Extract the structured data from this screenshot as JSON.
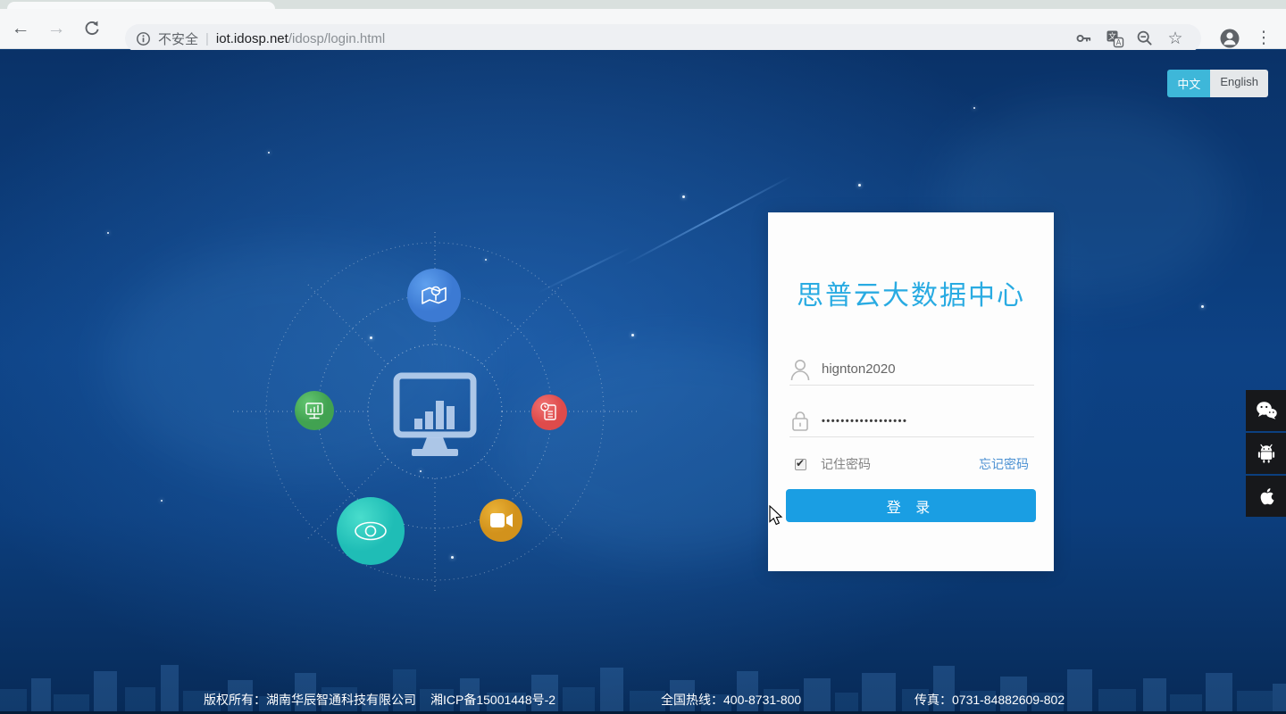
{
  "browser": {
    "security_label": "不安全",
    "url_separator": "|",
    "url_host": "iot.idosp.net",
    "url_path": "/idosp/login.html"
  },
  "language": {
    "chinese_label": "中文",
    "english_label": "English",
    "active": "中文"
  },
  "login": {
    "title": "思普云大数据中心",
    "username": {
      "value": "hignton2020"
    },
    "password": {
      "masked_value": "••••••••••••••••••"
    },
    "remember_label": "记住密码",
    "remember_checked": true,
    "forgot_password_label": "忘记密码",
    "login_button_label": "登 录"
  },
  "footer": {
    "copyright": "版权所有：湖南华辰智通科技有限公司",
    "icp_number": "湘ICP备15001448号-2",
    "hotline": "全国热线：400-8731-800",
    "fax": "传真：0731-84882609-802"
  },
  "colors": {
    "accent_button_blue": "#1a9ee3",
    "title_cyan": "#29abe2",
    "link_blue": "#4a90d2",
    "lang_active_bg": "#3eb7d9",
    "page_bg_top": "#0a3268",
    "page_bg_mid": "#0d4285",
    "hub_blue": "#4a8fe0",
    "hub_green": "#55b761",
    "hub_red": "#e85d5d",
    "hub_teal": "#2fd0c4",
    "hub_orange": "#df9f27",
    "social_bg": "#17181b"
  },
  "icons": {
    "back": "←",
    "forward": "→",
    "reload": "circular-arrow",
    "info": "circle-i",
    "key": "key-shape",
    "translate": "translate-squares",
    "zoom_out": "magnifier-minus",
    "bookmark": "☆",
    "profile": "avatar-circle",
    "menu": "⋮",
    "user_field": "person-outline",
    "password_field": "lock-outline",
    "social": [
      "wechat",
      "android",
      "apple"
    ],
    "hub": [
      "map-pin",
      "dashboard-monitor",
      "device-monitor",
      "report",
      "eye",
      "video-camera"
    ]
  }
}
